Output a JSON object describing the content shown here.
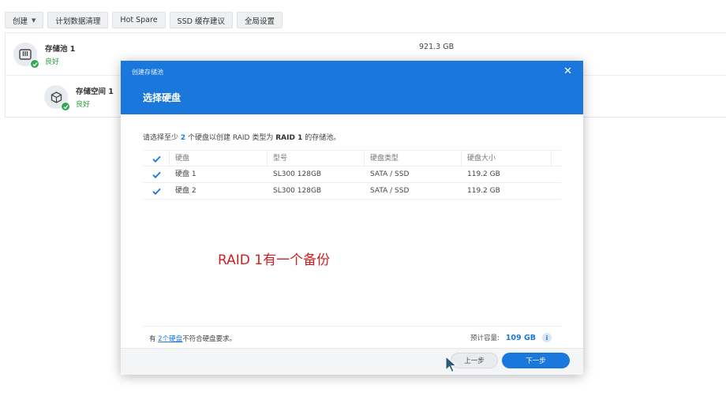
{
  "toolbar": {
    "create": "创建",
    "schedule_cleanup": "计划数据清理",
    "hot_spare": "Hot Spare",
    "ssd_cache": "SSD 缓存建议",
    "global_settings": "全局设置"
  },
  "pool": {
    "name": "存储池 1",
    "status": "良好",
    "size": "921.3 GB",
    "volume_name": "存储空间 1",
    "volume_status": "良好"
  },
  "dialog": {
    "small_title": "创建存储池",
    "title": "选择硬盘",
    "instruction_pre": "请选择至少 ",
    "instruction_count": "2",
    "instruction_mid": " 个硬盘以创建 RAID 类型为 ",
    "instruction_raid": "RAID 1",
    "instruction_post": " 的存储池。",
    "columns": [
      "硬盘",
      "型号",
      "硬盘类型",
      "硬盘大小"
    ],
    "rows": [
      {
        "disk": "硬盘 1",
        "model": "SL300 128GB",
        "type": "SATA / SSD",
        "size": "119.2 GB"
      },
      {
        "disk": "硬盘 2",
        "model": "SL300 128GB",
        "type": "SATA / SSD",
        "size": "119.2 GB"
      }
    ],
    "footnote_pre": "有 ",
    "footnote_link": "2个硬盘",
    "footnote_post": "不符合硬盘要求。",
    "capacity_label": "预计容量:",
    "capacity_value": "109 GB",
    "prev_button": "上一步",
    "next_button": "下一步"
  },
  "annotation": "RAID 1有一个备份",
  "colors": {
    "accent": "#1a78dd",
    "ok": "#34a853",
    "annotation": "#d01f1f"
  }
}
